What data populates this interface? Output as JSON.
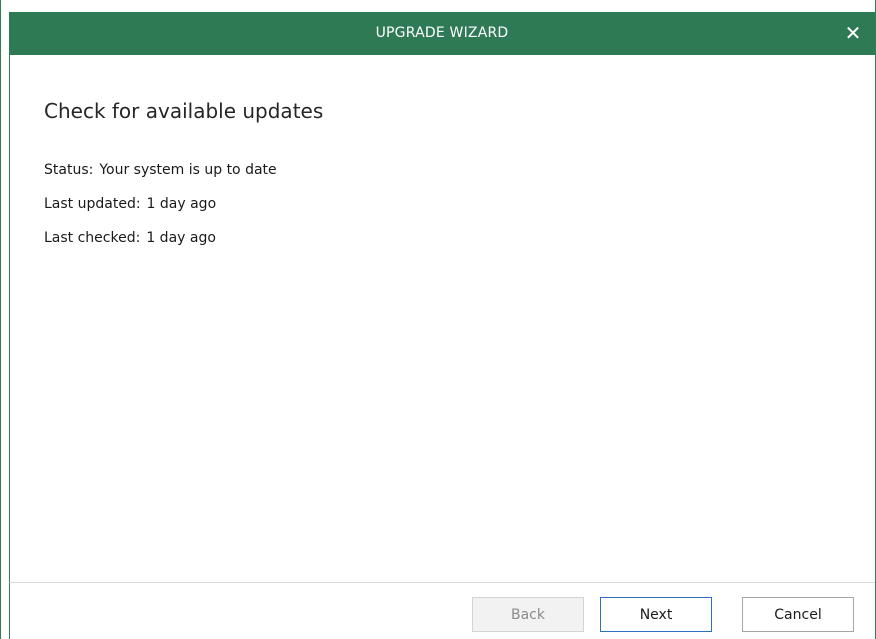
{
  "window": {
    "title": "UPGRADE WIZARD",
    "close_icon": "close-icon",
    "accent_color": "#2e7a55"
  },
  "page": {
    "title": "Check for available updates",
    "status_label": "Status:",
    "status_value": "Your system is up to date",
    "last_updated_label": "Last updated:",
    "last_updated_value": "1 day ago",
    "last_checked_label": "Last checked:",
    "last_checked_value": "1 day ago"
  },
  "footer": {
    "back_label": "Back",
    "back_enabled": false,
    "next_label": "Next",
    "cancel_label": "Cancel"
  }
}
